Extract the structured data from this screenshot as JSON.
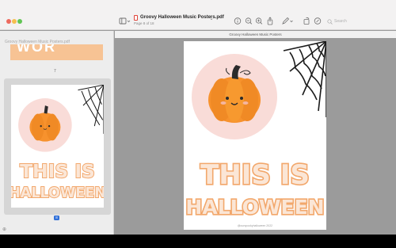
{
  "window": {
    "doc_title": "Groovy Halloween Music Posters.pdf",
    "page_indicator": "Page 8 of 18",
    "search_placeholder": "Search"
  },
  "sidebar": {
    "title": "Groovy Halloween Music Posters.pdf",
    "prev_page_number": "7",
    "selected_page_number": "8"
  },
  "main": {
    "tab_title": "Groovy Halloween Music Posters"
  },
  "poster": {
    "line1": "THIS IS",
    "line2": "HALLOWEEN",
    "footer": "@ourspookyhalloween 2022",
    "colors": {
      "circle": "#f9dcd8",
      "pumpkin": "#f7922d",
      "pumpkin_shade": "#e87e1c",
      "stem": "#2b2b2b",
      "text_fill": "#fbe6d6",
      "text_outline": "#f2a76b",
      "web": "#1a1a1a"
    }
  },
  "icons": {
    "sidebar_toggle": "sidebar-icon",
    "info": "info-icon",
    "zoom_out": "zoom-out-icon",
    "zoom_in": "zoom-in-icon",
    "share": "share-icon",
    "markup": "pen-icon",
    "rotate": "rotate-icon",
    "annotate": "markup-circle-icon",
    "search": "search-icon"
  }
}
